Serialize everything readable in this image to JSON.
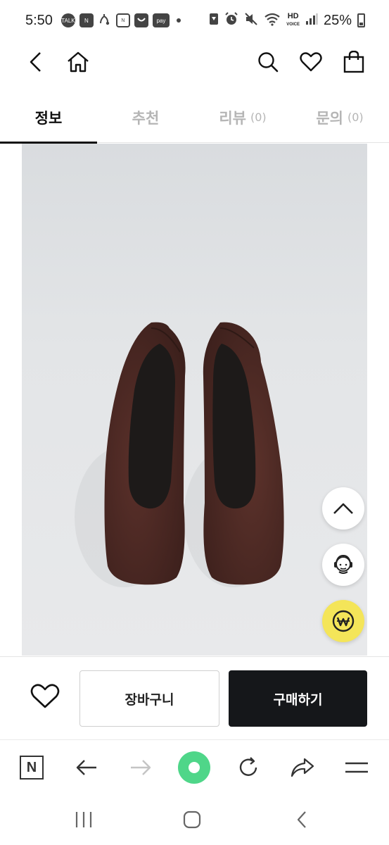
{
  "status_bar": {
    "time": "5:50",
    "left_icons": [
      "talk-icon",
      "naver-icon",
      "music-icon",
      "calendar-icon",
      "line-icon",
      "pay-icon"
    ],
    "talk_label": "TALK",
    "naver_label": "N",
    "pay_label": "pay",
    "battery": "25%",
    "right_icons": [
      "sync-icon",
      "alarm-icon",
      "mute-icon",
      "wifi-icon",
      "hd-voice-icon",
      "signal-icon",
      "battery-icon"
    ]
  },
  "top_nav": {
    "icons": [
      "back-icon",
      "home-icon",
      "search-icon",
      "heart-icon",
      "shopping-bag-icon"
    ]
  },
  "tabs": [
    {
      "label": "정보",
      "count": "",
      "active": true
    },
    {
      "label": "추천",
      "count": "",
      "active": false
    },
    {
      "label": "리뷰",
      "count": "(0)",
      "active": false
    },
    {
      "label": "문의",
      "count": "(0)",
      "active": false
    }
  ],
  "product": {
    "image": "brown-leather-flat-shoes",
    "image_colors": {
      "background": "#e3e5e7",
      "leather": "#4e2a25",
      "lining": "#1e1b1a"
    }
  },
  "floating": {
    "icons": [
      "chevron-up-icon",
      "support-agent-icon",
      "won-pay-icon"
    ],
    "accent": "#f4e559"
  },
  "buy_bar": {
    "cart_label": "장바구니",
    "purchase_label": "구매하기",
    "purchase_color": "#15171a"
  },
  "browser_bar": {
    "icons": [
      "naver-n-icon",
      "back-arrow-icon",
      "forward-arrow-icon",
      "green-dot-icon",
      "reload-icon",
      "share-icon",
      "menu-icon"
    ],
    "n_label": "N",
    "green": "#4fd689"
  },
  "system_nav": {
    "icons": [
      "recent-apps-icon",
      "home-square-icon",
      "back-chevron-icon"
    ]
  }
}
